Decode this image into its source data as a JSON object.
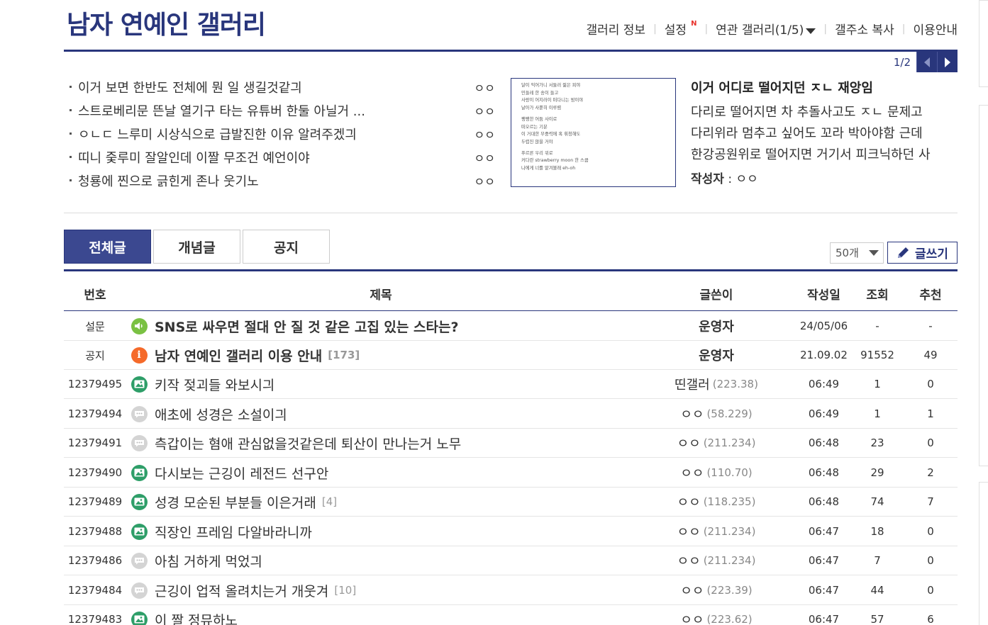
{
  "gallery_title": "남자 연예인 갤러리",
  "top_menu": {
    "info": "갤러리 정보",
    "settings": "설정",
    "settings_badge": "N",
    "related": "연관 갤러리(1/5)",
    "copy_address": "갤주소 복사",
    "guide": "이용안내"
  },
  "pager": "1/2",
  "recommended": [
    {
      "title": "이거 보면 한반도 전체에 뭔 일 생길것같긔",
      "writer": "ㅇㅇ"
    },
    {
      "title": "스트로베리문 뜬날 열기구 타는 유튜버 한둘 아닐거 ...",
      "writer": "ㅇㅇ"
    },
    {
      "title": "ㅇㄴㄷ 느루미 시상식으로 급발진한 이유 알려주겠긔",
      "writer": "ㅇㅇ"
    },
    {
      "title": "띠니 줒루미 잘알인데 이짤 무조건 예언이야",
      "writer": "ㅇㅇ"
    },
    {
      "title": "청룡에 찐으로 긁힌게 존나 웃기노",
      "writer": "ㅇㅇ"
    }
  ],
  "thumbnail_lines": [
    "달이 익어가니 서둘러 젊은 피야",
    "민들레 한 송이 들고",
    "사랑이 어지러이 떠다니는 밤이야",
    "날아가 사뿐히 이루렴",
    "",
    "팽팽한 어둠 사이로",
    "떠오르는 기분",
    "이 거대한 무중력에 혹 휘청해도",
    "두렵진 않을 거야",
    "",
    "푸르른 우리 위로",
    "커다란 strawberry moon 한 스쿱",
    "나에게 너를 맡겨볼래 eh-oh"
  ],
  "featured": {
    "title": "이거 어디로 떨어지던 ㅈㄴ 재앙임",
    "lines": [
      "다리로 떨어지면 차 추돌사고도 ㅈㄴ 문제고",
      "다리위라 멈추고 싶어도 꼬라 박아야함 근데",
      "한강공원위로 떨어지면 거기서 피크닉하던 사"
    ],
    "author_label": "작성자",
    "author": "ㅇㅇ"
  },
  "tabs": [
    "전체글",
    "개념글",
    "공지"
  ],
  "list_count": "50개",
  "write_label": "글쓰기",
  "columns": {
    "num": "번호",
    "title": "제목",
    "writer": "글쓴이",
    "date": "작성일",
    "views": "조회",
    "recommend": "추천"
  },
  "rows": [
    {
      "num": "설문",
      "icon": "survey-icon",
      "title": "SNS로 싸우면 절대 안 질 것 같은 고집 있는 스타는?",
      "reply": "",
      "writer": "운영자",
      "ip": "",
      "date": "24/05/06",
      "views": "-",
      "rec": "-"
    },
    {
      "num": "공지",
      "icon": "notice-icon",
      "title": "남자 연예인 갤러리 이용 안내",
      "reply": "[173]",
      "writer": "운영자",
      "ip": "",
      "date": "21.09.02",
      "views": "91552",
      "rec": "49"
    },
    {
      "num": "12379495",
      "icon": "image-post-icon",
      "title": "키작 젖괴들 와보시긔",
      "reply": "",
      "writer": "띤갤러",
      "ip": "(223.38)",
      "date": "06:49",
      "views": "1",
      "rec": "0"
    },
    {
      "num": "12379494",
      "icon": "text-post-icon",
      "title": "애초에 성경은 소설이긔",
      "reply": "",
      "writer": "ㅇㅇ",
      "ip": "(58.229)",
      "date": "06:49",
      "views": "1",
      "rec": "1"
    },
    {
      "num": "12379491",
      "icon": "text-post-icon",
      "title": "측갑이는 혐애 관심없을것같은데 퇴산이 만나는거 노무",
      "reply": "",
      "writer": "ㅇㅇ",
      "ip": "(211.234)",
      "date": "06:48",
      "views": "23",
      "rec": "0"
    },
    {
      "num": "12379490",
      "icon": "image-post-icon",
      "title": "다시보는 근깅이 레전드 선구안",
      "reply": "",
      "writer": "ㅇㅇ",
      "ip": "(110.70)",
      "date": "06:48",
      "views": "29",
      "rec": "2"
    },
    {
      "num": "12379489",
      "icon": "image-post-icon",
      "title": "성경 모순된 부분들 이은거래",
      "reply": "[4]",
      "writer": "ㅇㅇ",
      "ip": "(118.235)",
      "date": "06:48",
      "views": "74",
      "rec": "7"
    },
    {
      "num": "12379488",
      "icon": "image-post-icon",
      "title": "직장인 프레임 다알바라니까",
      "reply": "",
      "writer": "ㅇㅇ",
      "ip": "(211.234)",
      "date": "06:47",
      "views": "18",
      "rec": "0"
    },
    {
      "num": "12379486",
      "icon": "text-post-icon",
      "title": "아침 거하게 먹었긔",
      "reply": "",
      "writer": "ㅇㅇ",
      "ip": "(211.234)",
      "date": "06:47",
      "views": "7",
      "rec": "0"
    },
    {
      "num": "12379484",
      "icon": "text-post-icon",
      "title": "근깅이 업적 올려치는거 개웃겨",
      "reply": "[10]",
      "writer": "ㅇㅇ",
      "ip": "(223.39)",
      "date": "06:47",
      "views": "44",
      "rec": "0"
    },
    {
      "num": "12379483",
      "icon": "image-post-icon",
      "title": "이 짤 정뮤하노",
      "reply": "",
      "writer": "ㅇㅇ",
      "ip": "(223.62)",
      "date": "06:47",
      "views": "57",
      "rec": "6"
    }
  ]
}
